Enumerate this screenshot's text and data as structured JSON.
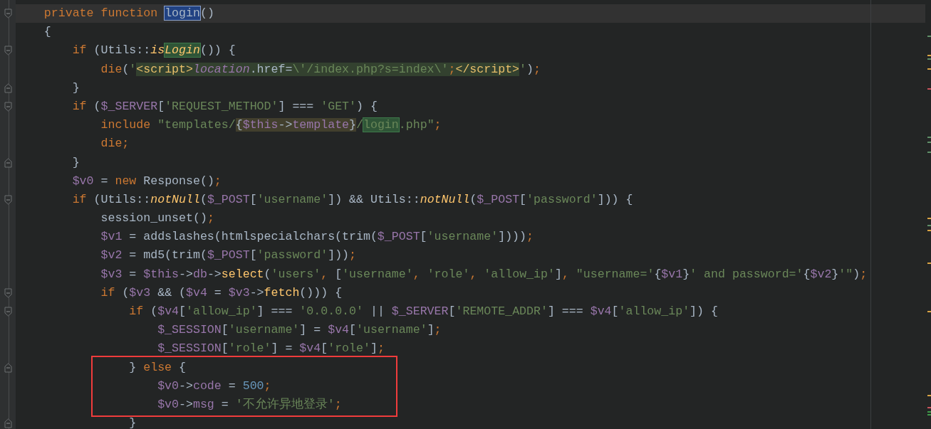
{
  "editor": {
    "lines": [
      {
        "current": true,
        "kind": "fold_start",
        "tokens": [
          {
            "kind": "keyword",
            "text": "    private"
          },
          {
            "kind": "keyword",
            "text": " function "
          },
          {
            "kind": "selection",
            "tokens": [
              {
                "kind": "plain",
                "text": "login"
              }
            ]
          },
          {
            "kind": "plain",
            "text": "()"
          }
        ]
      },
      {
        "current": false,
        "kind": "plain",
        "tokens": [
          {
            "kind": "plain",
            "text": "    {"
          }
        ]
      },
      {
        "current": false,
        "kind": "fold_start",
        "tokens": [
          {
            "kind": "keyword",
            "text": "        if"
          },
          {
            "kind": "plain",
            "text": " (Utils::"
          },
          {
            "kind": "static_call",
            "text": "is"
          },
          {
            "kind": "usage",
            "tokens": [
              {
                "kind": "static_call",
                "text": "Login"
              }
            ]
          },
          {
            "kind": "plain",
            "text": "()) {"
          }
        ]
      },
      {
        "current": false,
        "kind": "plain",
        "tokens": [
          {
            "kind": "keyword",
            "text": "            die"
          },
          {
            "kind": "plain",
            "text": "("
          },
          {
            "kind": "string",
            "text": "'"
          },
          {
            "kind": "injection",
            "tokens": [
              {
                "kind": "tag",
                "text": "<script>"
              },
              {
                "kind": "variable_italic",
                "text": "location"
              },
              {
                "kind": "plain",
                "text": ".href="
              },
              {
                "kind": "string",
                "text": "\\'/index.php?s=index\\'"
              },
              {
                "kind": "keyword",
                "text": ";"
              },
              {
                "kind": "tag",
                "text": "</script>"
              }
            ]
          },
          {
            "kind": "string",
            "text": "'"
          },
          {
            "kind": "plain",
            "text": ")"
          },
          {
            "kind": "keyword",
            "text": ";"
          }
        ]
      },
      {
        "current": false,
        "kind": "fold_end",
        "tokens": [
          {
            "kind": "plain",
            "text": "        }"
          }
        ]
      },
      {
        "current": false,
        "kind": "fold_start",
        "tokens": [
          {
            "kind": "keyword",
            "text": "        if"
          },
          {
            "kind": "plain",
            "text": " ("
          },
          {
            "kind": "variable",
            "text": "$_SERVER"
          },
          {
            "kind": "plain",
            "text": "["
          },
          {
            "kind": "string",
            "text": "'REQUEST_METHOD'"
          },
          {
            "kind": "plain",
            "text": "] === "
          },
          {
            "kind": "string",
            "text": "'GET'"
          },
          {
            "kind": "plain",
            "text": ") {"
          }
        ]
      },
      {
        "current": false,
        "kind": "plain",
        "tokens": [
          {
            "kind": "keyword",
            "text": "            include"
          },
          {
            "kind": "string",
            "text": " \"templates/"
          },
          {
            "kind": "interpolation",
            "tokens": [
              {
                "kind": "plain",
                "text": "{"
              },
              {
                "kind": "variable",
                "text": "$this"
              },
              {
                "kind": "plain",
                "text": "->"
              },
              {
                "kind": "variable",
                "text": "template"
              },
              {
                "kind": "plain",
                "text": "}"
              }
            ]
          },
          {
            "kind": "string",
            "text": "/"
          },
          {
            "kind": "usage",
            "tokens": [
              {
                "kind": "string",
                "text": "login"
              }
            ]
          },
          {
            "kind": "string",
            "text": ".php\""
          },
          {
            "kind": "keyword",
            "text": ";"
          }
        ]
      },
      {
        "current": false,
        "kind": "plain",
        "tokens": [
          {
            "kind": "keyword",
            "text": "            die;"
          }
        ]
      },
      {
        "current": false,
        "kind": "fold_end",
        "tokens": [
          {
            "kind": "plain",
            "text": "        }"
          }
        ]
      },
      {
        "current": false,
        "kind": "plain",
        "tokens": [
          {
            "kind": "variable",
            "text": "        $v0"
          },
          {
            "kind": "plain",
            "text": " = "
          },
          {
            "kind": "keyword",
            "text": "new"
          },
          {
            "kind": "plain",
            "text": " Response()"
          },
          {
            "kind": "keyword",
            "text": ";"
          }
        ]
      },
      {
        "current": false,
        "kind": "fold_start",
        "tokens": [
          {
            "kind": "keyword",
            "text": "        if"
          },
          {
            "kind": "plain",
            "text": " (Utils::"
          },
          {
            "kind": "static_call",
            "text": "notNull"
          },
          {
            "kind": "plain",
            "text": "("
          },
          {
            "kind": "variable",
            "text": "$_POST"
          },
          {
            "kind": "plain",
            "text": "["
          },
          {
            "kind": "string",
            "text": "'username'"
          },
          {
            "kind": "plain",
            "text": "]) && Utils::"
          },
          {
            "kind": "static_call",
            "text": "notNull"
          },
          {
            "kind": "plain",
            "text": "("
          },
          {
            "kind": "variable",
            "text": "$_POST"
          },
          {
            "kind": "plain",
            "text": "["
          },
          {
            "kind": "string",
            "text": "'password'"
          },
          {
            "kind": "plain",
            "text": "])) {"
          }
        ]
      },
      {
        "current": false,
        "kind": "plain",
        "tokens": [
          {
            "kind": "plain",
            "text": "            session_unset()"
          },
          {
            "kind": "keyword",
            "text": ";"
          }
        ]
      },
      {
        "current": false,
        "kind": "plain",
        "tokens": [
          {
            "kind": "variable",
            "text": "            $v1"
          },
          {
            "kind": "plain",
            "text": " = addslashes(htmlspecialchars(trim("
          },
          {
            "kind": "variable",
            "text": "$_POST"
          },
          {
            "kind": "plain",
            "text": "["
          },
          {
            "kind": "string",
            "text": "'username'"
          },
          {
            "kind": "plain",
            "text": "])))"
          },
          {
            "kind": "keyword",
            "text": ";"
          }
        ]
      },
      {
        "current": false,
        "kind": "plain",
        "tokens": [
          {
            "kind": "variable",
            "text": "            $v2"
          },
          {
            "kind": "plain",
            "text": " = md5(trim("
          },
          {
            "kind": "variable",
            "text": "$_POST"
          },
          {
            "kind": "plain",
            "text": "["
          },
          {
            "kind": "string",
            "text": "'password'"
          },
          {
            "kind": "plain",
            "text": "]))"
          },
          {
            "kind": "keyword",
            "text": ";"
          }
        ]
      },
      {
        "current": false,
        "kind": "plain",
        "tokens": [
          {
            "kind": "variable",
            "text": "            $v3"
          },
          {
            "kind": "plain",
            "text": " = "
          },
          {
            "kind": "variable",
            "text": "$this"
          },
          {
            "kind": "plain",
            "text": "->"
          },
          {
            "kind": "variable",
            "text": "db"
          },
          {
            "kind": "plain",
            "text": "->"
          },
          {
            "kind": "function",
            "text": "select"
          },
          {
            "kind": "plain",
            "text": "("
          },
          {
            "kind": "string",
            "text": "'users'"
          },
          {
            "kind": "keyword",
            "text": ","
          },
          {
            "kind": "plain",
            "text": " ["
          },
          {
            "kind": "string",
            "text": "'username'"
          },
          {
            "kind": "keyword",
            "text": ","
          },
          {
            "kind": "string",
            "text": " 'role'"
          },
          {
            "kind": "keyword",
            "text": ","
          },
          {
            "kind": "string",
            "text": " 'allow_ip'"
          },
          {
            "kind": "plain",
            "text": "]"
          },
          {
            "kind": "keyword",
            "text": ","
          },
          {
            "kind": "string",
            "text": " \"username='"
          },
          {
            "kind": "plain",
            "text": "{"
          },
          {
            "kind": "variable",
            "text": "$v1"
          },
          {
            "kind": "plain",
            "text": "}"
          },
          {
            "kind": "string",
            "text": "' and password='"
          },
          {
            "kind": "plain",
            "text": "{"
          },
          {
            "kind": "variable",
            "text": "$v2"
          },
          {
            "kind": "plain",
            "text": "}"
          },
          {
            "kind": "string",
            "text": "'\""
          },
          {
            "kind": "plain",
            "text": ")"
          },
          {
            "kind": "keyword",
            "text": ";"
          }
        ]
      },
      {
        "current": false,
        "kind": "fold_start",
        "tokens": [
          {
            "kind": "keyword",
            "text": "            if"
          },
          {
            "kind": "plain",
            "text": " ("
          },
          {
            "kind": "variable",
            "text": "$v3"
          },
          {
            "kind": "plain",
            "text": " && ("
          },
          {
            "kind": "variable",
            "text": "$v4"
          },
          {
            "kind": "plain",
            "text": " = "
          },
          {
            "kind": "variable",
            "text": "$v3"
          },
          {
            "kind": "plain",
            "text": "->"
          },
          {
            "kind": "function",
            "text": "fetch"
          },
          {
            "kind": "plain",
            "text": "())) {"
          }
        ]
      },
      {
        "current": false,
        "kind": "fold_start",
        "tokens": [
          {
            "kind": "keyword",
            "text": "                if"
          },
          {
            "kind": "plain",
            "text": " ("
          },
          {
            "kind": "variable",
            "text": "$v4"
          },
          {
            "kind": "plain",
            "text": "["
          },
          {
            "kind": "string",
            "text": "'allow_ip'"
          },
          {
            "kind": "plain",
            "text": "] === "
          },
          {
            "kind": "string",
            "text": "'0.0.0.0'"
          },
          {
            "kind": "plain",
            "text": " || "
          },
          {
            "kind": "variable",
            "text": "$_SERVER"
          },
          {
            "kind": "plain",
            "text": "["
          },
          {
            "kind": "string",
            "text": "'REMOTE_ADDR'"
          },
          {
            "kind": "plain",
            "text": "] === "
          },
          {
            "kind": "variable",
            "text": "$v4"
          },
          {
            "kind": "plain",
            "text": "["
          },
          {
            "kind": "string",
            "text": "'allow_ip'"
          },
          {
            "kind": "plain",
            "text": "]) {"
          }
        ]
      },
      {
        "current": false,
        "kind": "plain",
        "tokens": [
          {
            "kind": "variable",
            "text": "                    $_SESSION"
          },
          {
            "kind": "plain",
            "text": "["
          },
          {
            "kind": "string",
            "text": "'username'"
          },
          {
            "kind": "plain",
            "text": "] = "
          },
          {
            "kind": "variable",
            "text": "$v4"
          },
          {
            "kind": "plain",
            "text": "["
          },
          {
            "kind": "string",
            "text": "'username'"
          },
          {
            "kind": "plain",
            "text": "]"
          },
          {
            "kind": "keyword",
            "text": ";"
          }
        ]
      },
      {
        "current": false,
        "kind": "plain",
        "tokens": [
          {
            "kind": "variable",
            "text": "                    $_SESSION"
          },
          {
            "kind": "plain",
            "text": "["
          },
          {
            "kind": "string",
            "text": "'role'"
          },
          {
            "kind": "plain",
            "text": "] = "
          },
          {
            "kind": "variable",
            "text": "$v4"
          },
          {
            "kind": "plain",
            "text": "["
          },
          {
            "kind": "string",
            "text": "'role'"
          },
          {
            "kind": "plain",
            "text": "]"
          },
          {
            "kind": "keyword",
            "text": ";"
          }
        ]
      },
      {
        "current": false,
        "kind": "fold_end",
        "boxed": true,
        "tokens": [
          {
            "kind": "plain",
            "text": "                } "
          },
          {
            "kind": "keyword",
            "text": "else"
          },
          {
            "kind": "plain",
            "text": " {"
          }
        ]
      },
      {
        "current": false,
        "kind": "plain",
        "boxed": true,
        "tokens": [
          {
            "kind": "variable",
            "text": "                    $v0"
          },
          {
            "kind": "plain",
            "text": "->"
          },
          {
            "kind": "variable",
            "text": "code"
          },
          {
            "kind": "plain",
            "text": " = "
          },
          {
            "kind": "number",
            "text": "500"
          },
          {
            "kind": "keyword",
            "text": ";"
          }
        ]
      },
      {
        "current": false,
        "kind": "plain",
        "boxed": true,
        "tokens": [
          {
            "kind": "variable",
            "text": "                    $v0"
          },
          {
            "kind": "plain",
            "text": "->"
          },
          {
            "kind": "variable",
            "text": "msg"
          },
          {
            "kind": "plain",
            "text": " = "
          },
          {
            "kind": "string",
            "text": "'不允许异地登录'"
          },
          {
            "kind": "keyword",
            "text": ";"
          }
        ]
      },
      {
        "current": false,
        "kind": "fold_end",
        "tokens": [
          {
            "kind": "plain",
            "text": "                }"
          }
        ]
      }
    ],
    "stripe_marks": [
      {
        "color": "#5f8f68"
      },
      {
        "color": "#d9a343"
      },
      {
        "color": "#5f8f68"
      },
      {
        "color": "#d9a343"
      },
      {
        "color": "#c7525b"
      },
      {
        "color": "#5f8f68"
      },
      {
        "color": "#5f8f68"
      },
      {
        "color": "#5f8f68"
      },
      {
        "color": "#d9a343"
      },
      {
        "color": "#5f8f68"
      },
      {
        "color": "#d9a343"
      },
      {
        "color": "#d9a343"
      },
      {
        "color": "#d9a343"
      },
      {
        "color": "#d9a343"
      },
      {
        "color": "#c7525b"
      },
      {
        "color": "#3f9a4a"
      },
      {
        "color": "#3f9a4a"
      }
    ]
  }
}
